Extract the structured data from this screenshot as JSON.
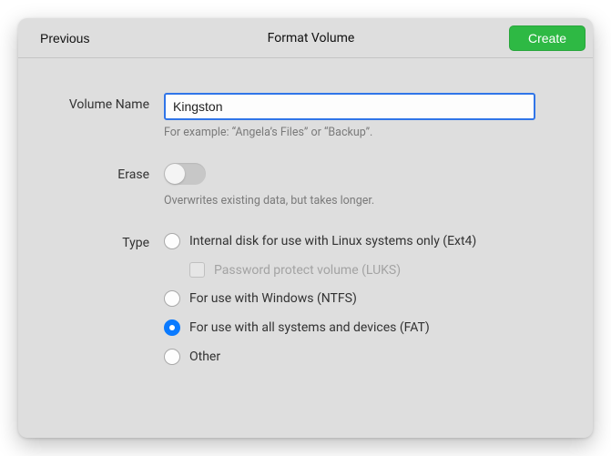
{
  "header": {
    "previous": "Previous",
    "title": "Format Volume",
    "create": "Create"
  },
  "volume_name": {
    "label": "Volume Name",
    "value": "Kingston",
    "hint": "For example: “Angela’s Files” or “Backup”."
  },
  "erase": {
    "label": "Erase",
    "hint": "Overwrites existing data, but takes longer.",
    "enabled": false
  },
  "type": {
    "label": "Type",
    "options": {
      "ext4": "Internal disk for use with Linux systems only (Ext4)",
      "luks": "Password protect volume (LUKS)",
      "ntfs": "For use with Windows (NTFS)",
      "fat": "For use with all systems and devices (FAT)",
      "other": "Other"
    },
    "selected": "fat"
  }
}
